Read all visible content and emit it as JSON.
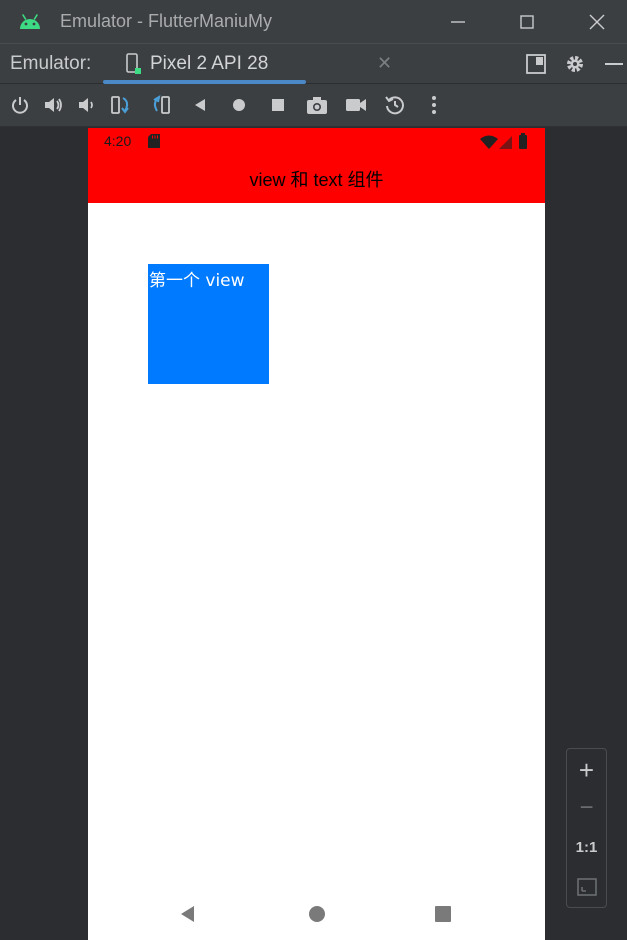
{
  "window": {
    "title": "Emulator - FlutterManiuMy"
  },
  "tabbar": {
    "label": "Emulator:",
    "tab_label": "Pixel 2 API 28"
  },
  "toolbar": {
    "icons": [
      "power-icon",
      "volume-up-icon",
      "volume-down-icon",
      "rotate-left-icon",
      "rotate-right-icon",
      "back-icon",
      "home-icon",
      "overview-icon",
      "screenshot-icon",
      "record-icon",
      "snapshot-icon",
      "more-icon"
    ]
  },
  "device": {
    "status_time": "4:20",
    "app_title": "view 和 text 组件",
    "view_text": "第一个 view",
    "colors": {
      "appbar": "#ff0000",
      "view": "#007aff"
    }
  },
  "zoom": {
    "plus": "+",
    "minus": "−",
    "one_to_one": "1:1"
  }
}
